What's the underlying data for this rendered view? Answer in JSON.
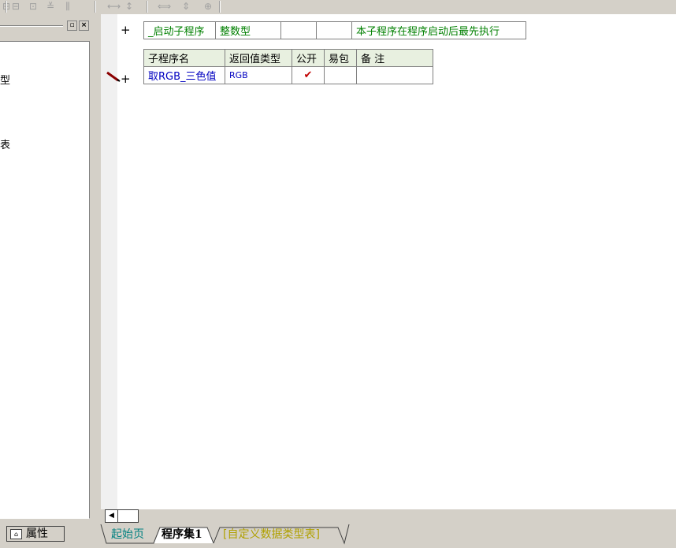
{
  "toolbar": {
    "icons": [
      "align-left-icon",
      "align-top-icon",
      "align-center-icon",
      "align-right-icon",
      "space-horizontal-icon",
      "space-vertical-icon",
      "same-width-icon",
      "same-height-icon",
      "same-size-icon"
    ]
  },
  "left_panel": {
    "tree_fragments": [
      "型",
      "表"
    ],
    "properties_tab_label": "属性"
  },
  "editor": {
    "startup_row": {
      "name": "_启动子程序",
      "return_type": "整数型",
      "public": "",
      "easy_pack": "",
      "note": "本子程序在程序启动后最先执行"
    },
    "sub_table": {
      "headers": [
        "子程序名",
        "返回值类型",
        "公开",
        "易包",
        "备 注"
      ],
      "rows": [
        {
          "name": "取RGB_三色值",
          "return_type": "RGB",
          "public": "✔",
          "easy_pack": "",
          "note": ""
        }
      ]
    }
  },
  "doc_tabs": {
    "start_page": "起始页",
    "program_set": "程序集1",
    "custom_types": "[自定义数据类型表]"
  },
  "colors": {
    "green_text": "#008000",
    "blue_text": "#0000c0",
    "checkmark": "#c00000",
    "header_bg": "#e8f0e0",
    "teal_tab": "#008080",
    "olive_tab": "#b0a000"
  }
}
